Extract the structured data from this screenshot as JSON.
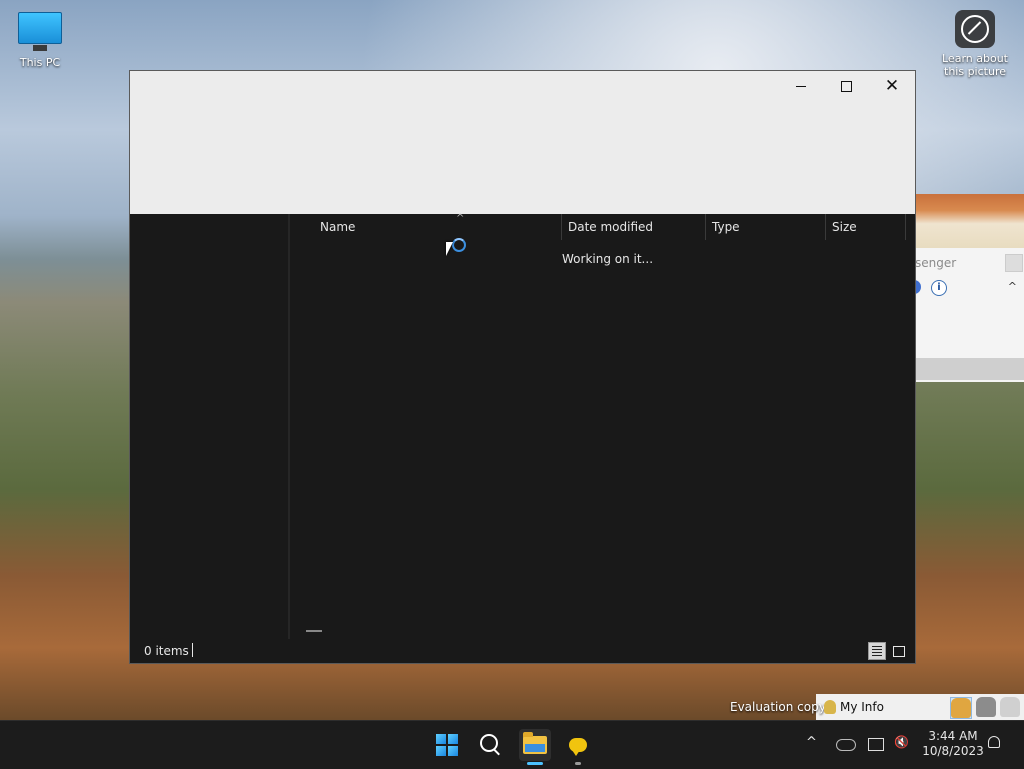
{
  "desktop": {
    "icons": [
      {
        "label": "This PC"
      },
      {
        "label": "Learn about this picture"
      }
    ]
  },
  "messenger": {
    "title_fragment": "senger",
    "info_glyph": "i",
    "chevron_glyph": "^",
    "eval_text": "Evaluation copy",
    "my_info": "My Info"
  },
  "explorer": {
    "columns": [
      "Name",
      "Date modified",
      "Type",
      "Size"
    ],
    "sort_glyph": "^",
    "working_text": "Working on it...",
    "status_items": "0 items",
    "close_glyph": "✕"
  },
  "taskbar": {
    "chevron_glyph": "^",
    "volume_glyph": "🔇",
    "time": "3:44 AM",
    "date": "10/8/2023"
  },
  "colors": {
    "accent": "#4cc2ff",
    "window_bg": "#191919",
    "taskbar_bg": "#1c1c1c"
  }
}
